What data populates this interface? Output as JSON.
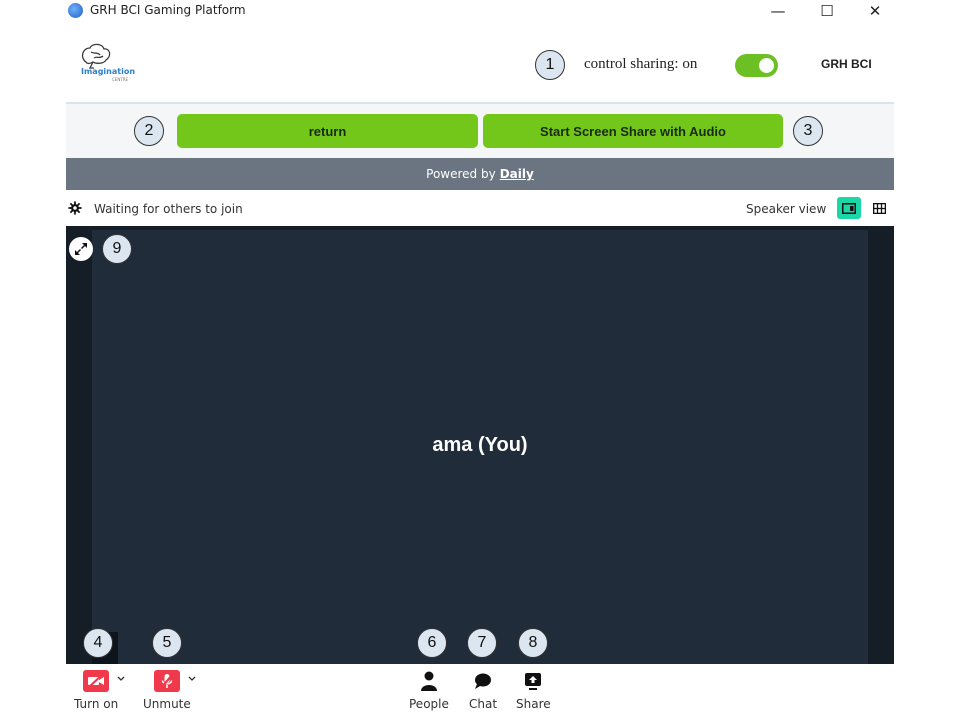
{
  "window": {
    "title": "GRH BCI Gaming Platform",
    "controls": {
      "minimize": "—",
      "maximize": "☐",
      "close": "✕"
    }
  },
  "header": {
    "logo_text": "Imagination",
    "logo_subtext": "CENTRE",
    "control_sharing_label": "control sharing: on",
    "control_sharing_enabled": true,
    "user_name": "GRH BCI"
  },
  "action_bar": {
    "return_label": "return",
    "screen_share_label": "Start Screen Share with Audio"
  },
  "powered_by": {
    "prefix": "Powered by",
    "link_text": "Daily"
  },
  "status": {
    "waiting_text": "Waiting for others to join",
    "speaker_view_label": "Speaker view"
  },
  "video": {
    "participant_name": "ama (You)"
  },
  "tray": {
    "camera_label": "Turn on",
    "mic_label": "Unmute",
    "people_label": "People",
    "chat_label": "Chat",
    "share_label": "Share"
  },
  "annotations": {
    "a1": "1",
    "a2": "2",
    "a3": "3",
    "a4": "4",
    "a5": "5",
    "a6": "6",
    "a7": "7",
    "a8": "8",
    "a9": "9"
  },
  "colors": {
    "accent_green": "#73c71b",
    "toggle_green": "#6cc024",
    "powered_bar": "#6b7582",
    "video_bg": "#212c3b",
    "active_view": "#1bd7a6",
    "muted_red": "#f03a4b"
  }
}
